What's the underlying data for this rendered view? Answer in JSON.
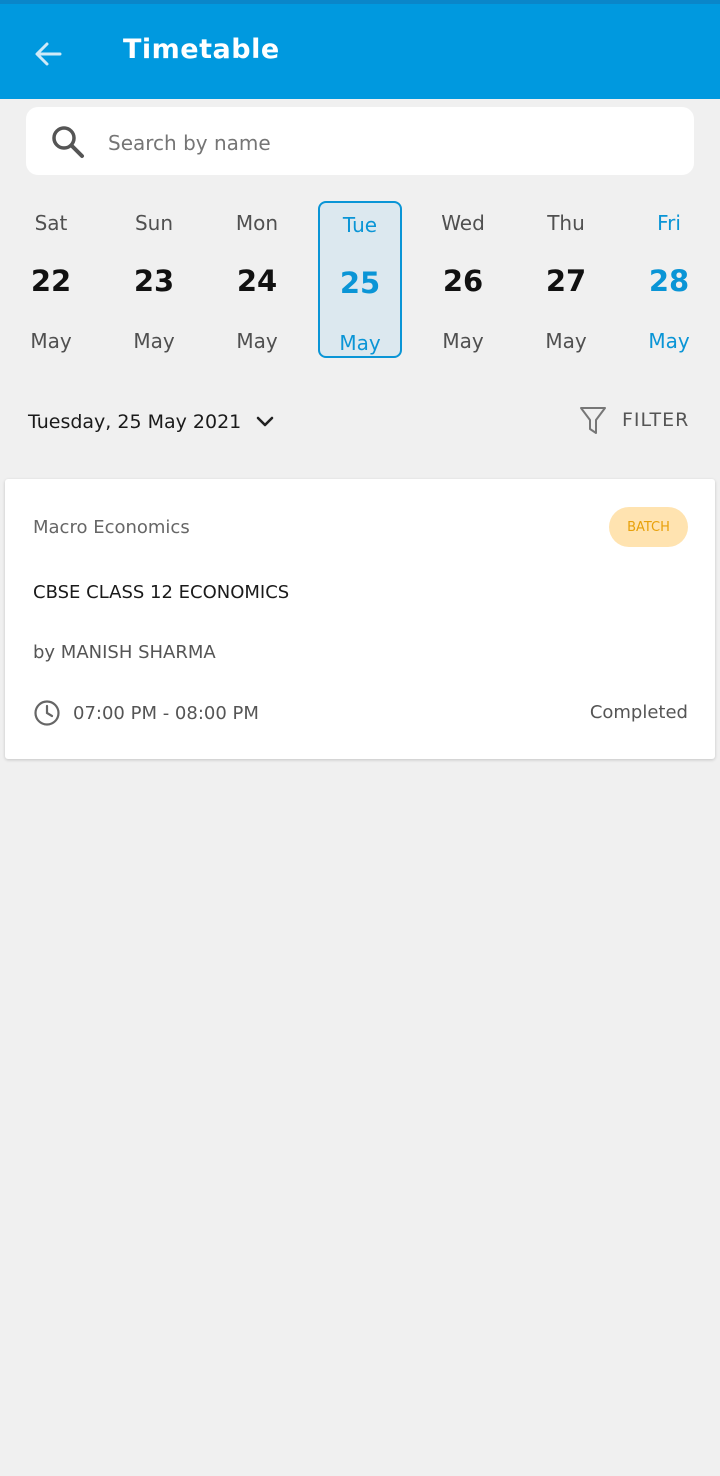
{
  "app": {
    "title": "Timetable"
  },
  "colors": {
    "primary": "#0099df",
    "accent": "#0a95d6",
    "badge_bg": "#ffe3b0",
    "badge_text": "#e8a10a"
  },
  "search": {
    "placeholder": "Search by name",
    "value": ""
  },
  "week": [
    {
      "day": "Sat",
      "date": "22",
      "month": "May",
      "selected": false,
      "accent": false
    },
    {
      "day": "Sun",
      "date": "23",
      "month": "May",
      "selected": false,
      "accent": false
    },
    {
      "day": "Mon",
      "date": "24",
      "month": "May",
      "selected": false,
      "accent": false
    },
    {
      "day": "Tue",
      "date": "25",
      "month": "May",
      "selected": true,
      "accent": false
    },
    {
      "day": "Wed",
      "date": "26",
      "month": "May",
      "selected": false,
      "accent": false
    },
    {
      "day": "Thu",
      "date": "27",
      "month": "May",
      "selected": false,
      "accent": false
    },
    {
      "day": "Fri",
      "date": "28",
      "month": "May",
      "selected": false,
      "accent": true
    }
  ],
  "date_selector": {
    "label": "Tuesday, 25 May 2021"
  },
  "filter": {
    "label": "FILTER"
  },
  "sessions": [
    {
      "subject": "Macro Economics",
      "badge": "BATCH",
      "course": "CBSE CLASS 12 ECONOMICS",
      "teacher": "by MANISH SHARMA",
      "time": "07:00 PM - 08:00 PM",
      "status": "Completed"
    }
  ],
  "icons": {
    "back": "arrow-left-icon",
    "search": "search-icon",
    "dropdown": "chevron-down-icon",
    "filter": "funnel-icon",
    "clock": "clock-icon"
  }
}
